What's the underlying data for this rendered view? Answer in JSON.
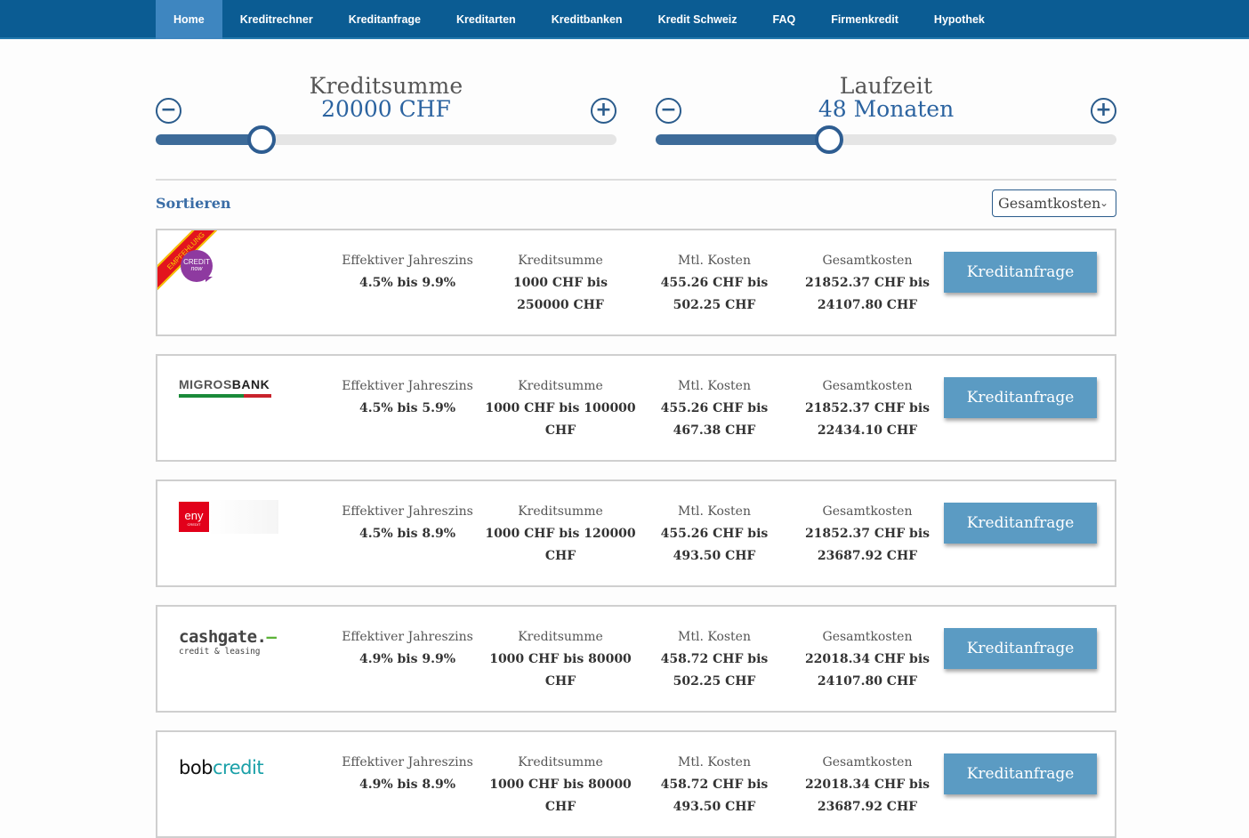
{
  "nav": {
    "items": [
      {
        "label": "Home",
        "active": true
      },
      {
        "label": "Kreditrechner"
      },
      {
        "label": "Kreditanfrage"
      },
      {
        "label": "Kreditarten"
      },
      {
        "label": "Kreditbanken"
      },
      {
        "label": "Kredit Schweiz"
      },
      {
        "label": "FAQ"
      },
      {
        "label": "Firmenkredit"
      },
      {
        "label": "Hypothek"
      }
    ],
    "bg_color": "#0b5c93",
    "active_color": "#3e86c0"
  },
  "sliders": {
    "amount": {
      "title": "Kreditsumme",
      "value": "20000 CHF",
      "level": 0.229
    },
    "term": {
      "title": "Laufzeit",
      "value": "48 Monaten",
      "level": 0.377
    }
  },
  "sort": {
    "label": "Sortieren",
    "selected": "Gesamtkosten"
  },
  "accent_color": "#2b63a0",
  "button_color": "#5b9bc3",
  "offers": [
    {
      "logo": "creditnow-logo",
      "ribbon": "EMPFEHLUNG",
      "logo_text": {
        "line1": "CREDIT",
        "line2": "now"
      },
      "labels": [
        "Effektiver Jahreszins",
        "Kreditsumme",
        "Mtl. Kosten",
        "Gesamtkosten"
      ],
      "values": [
        [
          "4.5% bis 9.9%"
        ],
        [
          "1000 CHF bis",
          "250000 CHF"
        ],
        [
          "455.26 CHF bis",
          "502.25 CHF"
        ],
        [
          "21852.37 CHF bis",
          "24107.80 CHF"
        ]
      ],
      "button": "Kreditanfrage"
    },
    {
      "logo": "migrosbank-logo",
      "logo_text": {
        "part1": "MIGROS",
        "part2": "BANK"
      },
      "labels": [
        "Effektiver Jahreszins",
        "Kreditsumme",
        "Mtl. Kosten",
        "Gesamtkosten"
      ],
      "values": [
        [
          "4.5% bis 5.9%"
        ],
        [
          "1000 CHF bis 100000 CHF"
        ],
        [
          "455.26 CHF bis",
          "467.38 CHF"
        ],
        [
          "21852.37 CHF bis",
          "22434.10 CHF"
        ]
      ],
      "button": "Kreditanfrage"
    },
    {
      "logo": "eny-logo",
      "logo_text": {
        "main": "eny",
        "sub": "CREDIT"
      },
      "labels": [
        "Effektiver Jahreszins",
        "Kreditsumme",
        "Mtl. Kosten",
        "Gesamtkosten"
      ],
      "values": [
        [
          "4.5% bis 8.9%"
        ],
        [
          "1000 CHF bis 120000 CHF"
        ],
        [
          "455.26 CHF bis",
          "493.50 CHF"
        ],
        [
          "21852.37 CHF bis",
          "23687.92 CHF"
        ]
      ],
      "button": "Kreditanfrage"
    },
    {
      "logo": "cashgate-logo",
      "logo_text": {
        "main": "cashgate.",
        "dash": "–",
        "sub": "credit & leasing"
      },
      "labels": [
        "Effektiver Jahreszins",
        "Kreditsumme",
        "Mtl. Kosten",
        "Gesamtkosten"
      ],
      "values": [
        [
          "4.9% bis 9.9%"
        ],
        [
          "1000 CHF bis 80000 CHF"
        ],
        [
          "458.72 CHF bis",
          "502.25 CHF"
        ],
        [
          "22018.34 CHF bis",
          "24107.80 CHF"
        ]
      ],
      "button": "Kreditanfrage"
    },
    {
      "logo": "bobcredit-logo",
      "logo_text": {
        "part1": "bob",
        "part2": "credit"
      },
      "labels": [
        "Effektiver Jahreszins",
        "Kreditsumme",
        "Mtl. Kosten",
        "Gesamtkosten"
      ],
      "values": [
        [
          "4.9% bis 8.9%"
        ],
        [
          "1000 CHF bis 80000 CHF"
        ],
        [
          "458.72 CHF bis",
          "493.50 CHF"
        ],
        [
          "22018.34 CHF bis",
          "23687.92 CHF"
        ]
      ],
      "button": "Kreditanfrage"
    }
  ]
}
